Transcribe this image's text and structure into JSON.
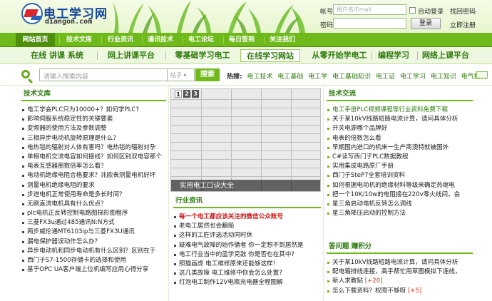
{
  "logo": {
    "cn": "电工学习网",
    "en": "diangon.com"
  },
  "login": {
    "account_label": "帐号",
    "account_placeholder": "用户名/Email",
    "password_label": "密码",
    "auto_login": "自动登录",
    "forgot": "找回密码",
    "submit": "登录",
    "register": "立即注册"
  },
  "nav_main": [
    "网站首页",
    "技术文库",
    "行业资讯",
    "通讯技术",
    "电工论坛",
    "每日签到",
    "关注我们"
  ],
  "nav_sub": [
    "在线 讲课 系统",
    "网上讲课平台",
    "零基础学习电工",
    "在线学习网站",
    "从零开始学电工",
    "编程学习",
    "网络上课平台"
  ],
  "search": {
    "placeholder": "请输入搜索内容",
    "type": "帖子",
    "button": "搜索",
    "hot_label": "热搜:",
    "hot_terms": [
      "电工技术",
      "电工基础",
      "电工学",
      "电工基础知识",
      "电工证",
      "电工学习",
      "电工知识",
      "电气控制"
    ]
  },
  "left": {
    "title": "技术文库",
    "items": [
      "电工学会PLC只为10000+？如何学PLC?",
      "影响伺服系统稳定性的关键要素",
      "变频器的使用方法及参数调整",
      "三相异步电动机旋转原理是什么？",
      "电热毯的辐射对人体有害吗？电热毯的辐射对孕",
      "单相电机交流电容如何接线？如何区别双电容那个",
      "电表互感器圈数倍率怎么看？",
      "电动机绝缘电阻合格要求？兆欧表测量电机好坏",
      "测量电机绝缘电阻的要求",
      "步进电机正常使用寿命是多长时间？",
      "无刷直流电机具有什么优点？",
      "plc电机正反转控制电路图梯形图程序",
      "三菱FX3u通过485通讯N:N方式",
      "两步威伦通MT6103ip与三菱FX3U通讯",
      "漏电保护器误动作怎么办？",
      "异步电动机和同步电动机有什么区别？区别在于",
      "西门子S7-1500存储卡的选择和使用",
      "基于OPC UA客户端上位机编写应用心得分享"
    ]
  },
  "middle": {
    "slider_caption": "实用电工口诀大全",
    "pages": [
      "1",
      "2",
      "3"
    ],
    "title": "行业资讯",
    "items": [
      "每一个电工都应该关注的微信公众账号",
      "老电工居然也会翻船",
      "这样的工匠评选活动同时休",
      "疑难电气故障的始作俑者 你一定想不到居然是",
      "电工行业当中的蓝学克敌 你是否也在其中?",
      "照猫画虎 电工维修原来还能够这样!",
      "这几类故障 电工维修中你会怎么处置?",
      "灯泡电工制作12V电瓶充电器全程图解"
    ]
  },
  "right": {
    "title": "技术交流",
    "items": [
      "电工手册PLC视频课程等行业资料免费下载",
      "关于某10kV线路短路电流计算，请问具体分析",
      "开关电源哪个品牌好",
      "电表的倍数怎么看",
      "早期国内进口的机床一生产商澳特就被国外",
      "C#读写西门子PLC数据教程",
      "实用集成电路原厂手册",
      "西门子SteP7全套培训资料",
      "如何根据电动机的绝缘材料等级来确定热继电",
      "把一个10K/10w的电阻接在220v零火线间，会",
      "星三角启动电机反转怎么调线",
      "星三角降压启动的控制方法"
    ],
    "qa_title": "答问题 赚积分",
    "qa_items": [
      {
        "text": "关于某10kV线路短路电流计算，请问具体分析",
        "bonus": ""
      },
      {
        "text": "配电箱排线连接，高手帮忙用草图模拟下连线，",
        "bonus": ""
      },
      {
        "text": "新人求教贴",
        "bonus": "[+20]"
      },
      {
        "text": "怎么下载资料？权限不够呀",
        "bonus": "[+5]"
      }
    ]
  }
}
